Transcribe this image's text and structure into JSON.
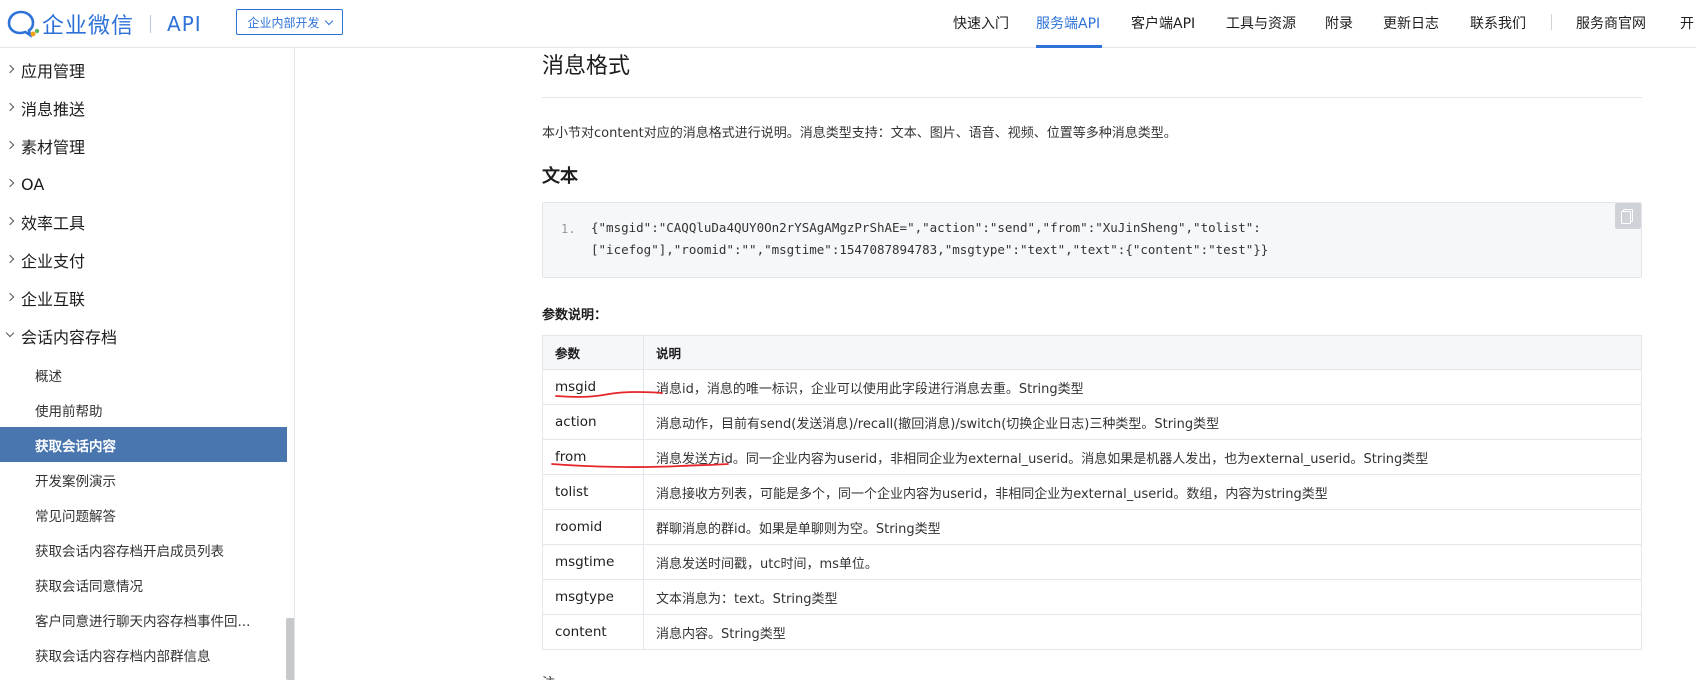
{
  "header": {
    "logo_text": "企业微信",
    "logo_api": "API",
    "scope_select": "企业内部开发",
    "nav": [
      {
        "label": "快速入门",
        "active": false
      },
      {
        "label": "服务端API",
        "active": true
      },
      {
        "label": "客户端API",
        "active": false
      },
      {
        "label": "工具与资源",
        "active": false
      },
      {
        "label": "附录",
        "active": false
      },
      {
        "label": "更新日志",
        "active": false
      },
      {
        "label": "联系我们",
        "active": false
      },
      {
        "label": "服务商官网",
        "active": false
      },
      {
        "label": "开",
        "active": false
      }
    ]
  },
  "sidebar": {
    "sections": [
      {
        "label": "应用管理"
      },
      {
        "label": "消息推送"
      },
      {
        "label": "素材管理"
      },
      {
        "label": "OA"
      },
      {
        "label": "效率工具"
      },
      {
        "label": "企业支付"
      },
      {
        "label": "企业互联"
      },
      {
        "label": "会话内容存档"
      }
    ],
    "children": [
      {
        "label": "概述"
      },
      {
        "label": "使用前帮助"
      },
      {
        "label": "获取会话内容"
      },
      {
        "label": "开发案例演示"
      },
      {
        "label": "常见问题解答"
      },
      {
        "label": "获取会话内容存档开启成员列表"
      },
      {
        "label": "获取会话同意情况"
      },
      {
        "label": "客户同意进行聊天内容存档事件回..."
      },
      {
        "label": "获取会话内容存档内部群信息"
      }
    ]
  },
  "main": {
    "title": "消息格式",
    "intro": "本小节对content对应的消息格式进行说明。消息类型支持：文本、图片、语音、视频、位置等多种消息类型。",
    "subtitle": "文本",
    "code": {
      "line_number": "1.",
      "line1": "{\"msgid\":\"CAQQluDa4QUY0On2rYSAgAMgzPrShAE=\",\"action\":\"send\",\"from\":\"XuJinSheng\",\"tolist\":",
      "line2": "[\"icefog\"],\"roomid\":\"\",\"msgtime\":1547087894783,\"msgtype\":\"text\",\"text\":{\"content\":\"test\"}}"
    },
    "params_label": "参数说明：",
    "table": {
      "headers": [
        "参数",
        "说明"
      ],
      "rows": [
        {
          "param": "msgid",
          "desc": "消息id，消息的唯一标识，企业可以使用此字段进行消息去重。String类型"
        },
        {
          "param": "action",
          "desc": "消息动作，目前有send(发送消息)/recall(撤回消息)/switch(切换企业日志)三种类型。String类型"
        },
        {
          "param": "from",
          "desc": "消息发送方id。同一企业内容为userid，非相同企业为external_userid。消息如果是机器人发出，也为external_userid。String类型"
        },
        {
          "param": "tolist",
          "desc": "消息接收方列表，可能是多个，同一个企业内容为userid，非相同企业为external_userid。数组，内容为string类型"
        },
        {
          "param": "roomid",
          "desc": "群聊消息的群id。如果是单聊则为空。String类型"
        },
        {
          "param": "msgtime",
          "desc": "消息发送时间戳，utc时间，ms单位。"
        },
        {
          "param": "msgtype",
          "desc": "文本消息为：text。String类型"
        },
        {
          "param": "content",
          "desc": "消息内容。String类型"
        }
      ]
    },
    "trailing": "注"
  },
  "colors": {
    "brand": "#2e72d8",
    "sidebar_active": "#4a76b0",
    "annotation_red": "#e5252a"
  }
}
